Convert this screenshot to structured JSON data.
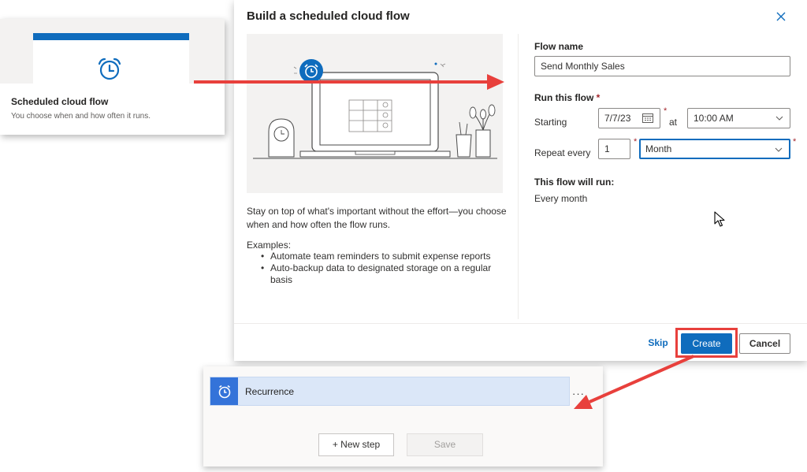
{
  "left_card": {
    "title": "Scheduled cloud flow",
    "description": "You choose when and how often it runs."
  },
  "dialog": {
    "title": "Build a scheduled cloud flow",
    "description": "Stay on top of what's important without the effort—you choose when and how often the flow runs.",
    "examples_label": "Examples:",
    "examples": [
      "Automate team reminders to submit expense reports",
      "Auto-backup data to designated storage on a regular basis"
    ],
    "form": {
      "flow_name_label": "Flow name",
      "flow_name_value": "Send Monthly Sales",
      "run_label": "Run this flow",
      "required_marker": "*",
      "starting_label": "Starting",
      "start_date": "7/7/23",
      "at_label": "at",
      "start_time": "10:00 AM",
      "repeat_label": "Repeat every",
      "repeat_interval": "1",
      "repeat_unit": "Month",
      "summary_label": "This flow will run:",
      "summary_value": "Every month"
    },
    "buttons": {
      "skip": "Skip",
      "create": "Create",
      "cancel": "Cancel"
    }
  },
  "recurrence_card": {
    "step_label": "Recurrence",
    "more_label": "···",
    "new_step_label": "+ New step",
    "save_label": "Save"
  },
  "colors": {
    "accent": "#0f6cbd",
    "annotation": "#e8403c",
    "recurrence_bar": "#dbe7f8",
    "recurrence_icon_bg": "#3473d9"
  },
  "icons": [
    "alarm-clock-icon",
    "close-icon",
    "calendar-icon",
    "chevron-down-icon",
    "timer-icon",
    "mouse-cursor-icon"
  ]
}
